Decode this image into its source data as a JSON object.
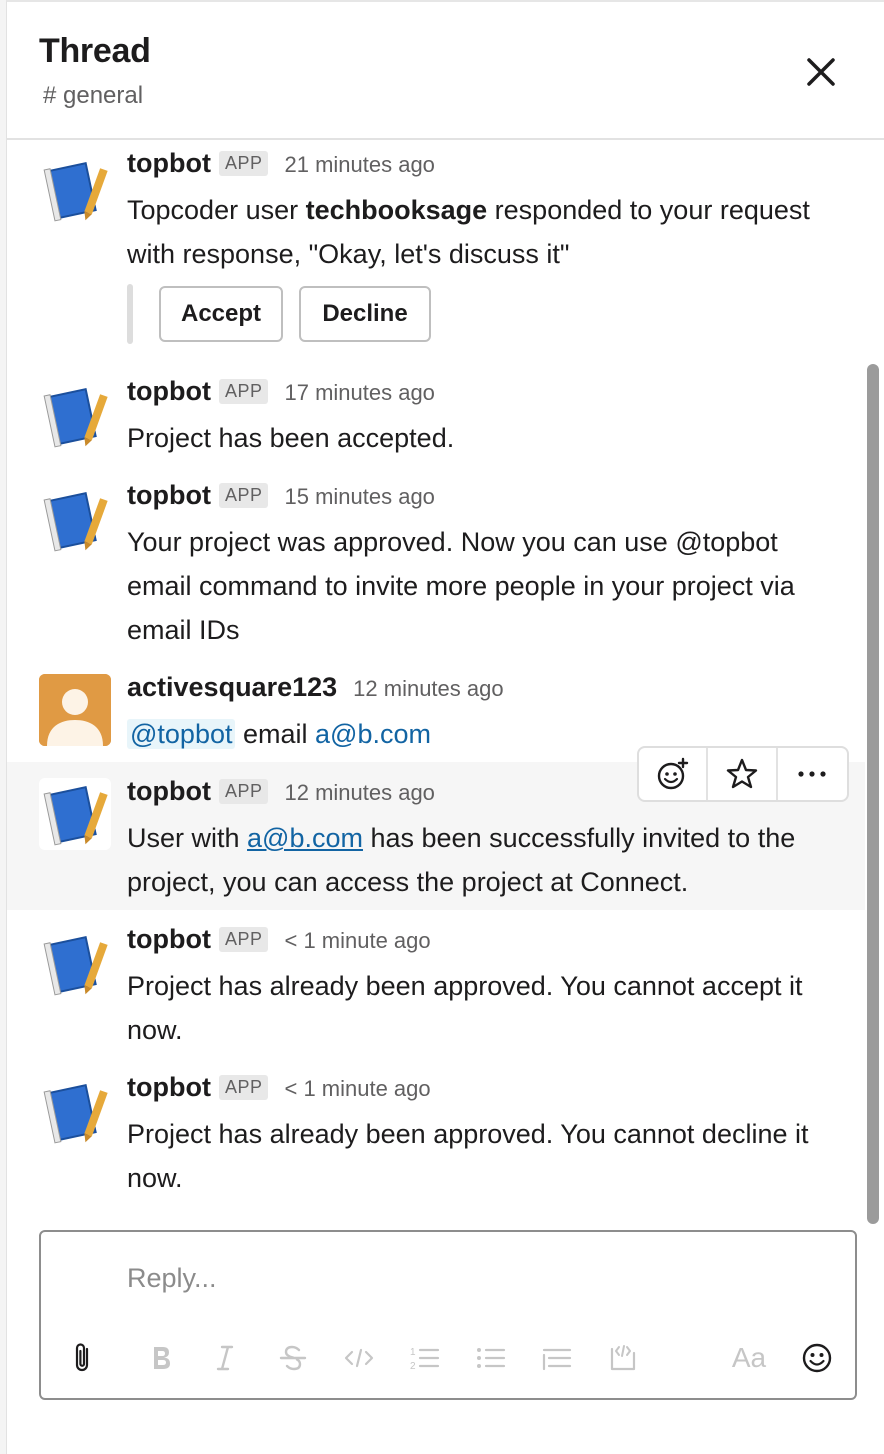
{
  "header": {
    "title": "Thread",
    "channel": "# general"
  },
  "messages": [
    {
      "sender": "topbot",
      "badge": "APP",
      "time": "21 minutes ago",
      "text_pre": "Topcoder user ",
      "text_bold": "techbooksage",
      "text_post": " responded to your request with response, \"Okay, let's discuss it\"",
      "actions": [
        "Accept",
        "Decline"
      ]
    },
    {
      "sender": "topbot",
      "badge": "APP",
      "time": "17 minutes ago",
      "text": "Project has been accepted."
    },
    {
      "sender": "topbot",
      "badge": "APP",
      "time": "15 minutes ago",
      "text": "Your project was approved. Now you can use @topbot email command to invite more people in your project via email IDs"
    },
    {
      "sender": "activesquare123",
      "time": "12 minutes ago",
      "mention": "@topbot",
      "text_mid": " email ",
      "link": "a@b.com"
    },
    {
      "sender": "topbot",
      "badge": "APP",
      "time": "12 minutes ago",
      "text_pre": "User with ",
      "link": "a@b.com",
      "text_post": " has been successfully invited to the project, you can access the project at Connect."
    },
    {
      "sender": "topbot",
      "badge": "APP",
      "time": "< 1 minute ago",
      "text": "Project has already been approved. You cannot accept it now."
    },
    {
      "sender": "topbot",
      "badge": "APP",
      "time": "< 1 minute ago",
      "text": "Project has already been approved. You cannot decline it now."
    }
  ],
  "hover_toolbar": {
    "icons": [
      "add-reaction-icon",
      "star-icon",
      "more-actions-icon"
    ]
  },
  "composer": {
    "placeholder": "Reply...",
    "format_font_label": "Aa",
    "icons": [
      "attach-icon",
      "bold-icon",
      "italic-icon",
      "strikethrough-icon",
      "code-icon",
      "ordered-list-icon",
      "bulleted-list-icon",
      "blockquote-icon",
      "code-block-icon",
      "format-toggle-icon",
      "emoji-icon"
    ]
  },
  "colors": {
    "link": "#1264a3",
    "mention_bg": "#e8f5fa",
    "user_avatar_bg": "#e09a44",
    "bot_avatar_book": "#2f6fd0"
  }
}
